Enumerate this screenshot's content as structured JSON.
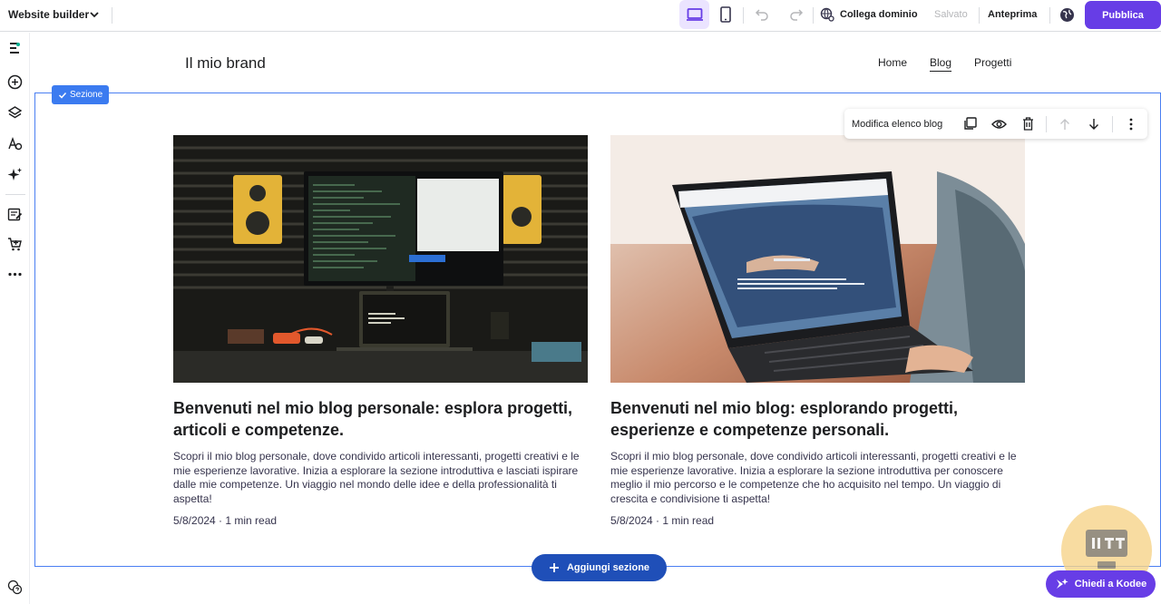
{
  "topbar": {
    "app_title": "Website builder",
    "connect_domain": "Collega dominio",
    "saved_status": "Salvato",
    "preview": "Anteprima",
    "publish": "Pubblica",
    "accent_color": "#673de6"
  },
  "sidebar": {
    "icons": [
      "logo-icon",
      "add-icon",
      "layers-icon",
      "styles-icon",
      "ai-sparkle-icon",
      "blog-icon",
      "store-icon",
      "more-icon",
      "help-icon"
    ]
  },
  "site": {
    "brand": "Il mio brand",
    "nav": [
      "Home",
      "Blog",
      "Progetti"
    ]
  },
  "section": {
    "badge": "Sezione",
    "toolbar_label": "Modifica elenco blog"
  },
  "posts": [
    {
      "title": "Benvenuti nel mio blog personale: esplora progetti, articoli e competenze.",
      "excerpt": "Scopri il mio blog personale, dove condivido articoli interessanti, progetti creativi e le mie esperienze lavorative. Inizia a esplorare la sezione introduttiva e lasciati ispirare dalle mie competenze. Un viaggio nel mondo delle idee e della professionalità ti aspetta!",
      "meta": "5/8/2024 · 1 min read"
    },
    {
      "title": "Benvenuti nel mio blog: esplorando progetti, esperienze e competenze personali.",
      "excerpt": "Scopri il mio blog personale, dove condivido articoli interessanti, progetti creativi e le mie esperienze lavorative. Inizia a esplorare la sezione introduttiva per conoscere meglio il mio percorso e le competenze che ho acquisito nel tempo. Un viaggio di crescita e condivisione ti aspetta!",
      "meta": "5/8/2024 · 1 min read"
    }
  ],
  "add_section": "Aggiungi sezione",
  "assistant": "Chiedi a Kodee"
}
